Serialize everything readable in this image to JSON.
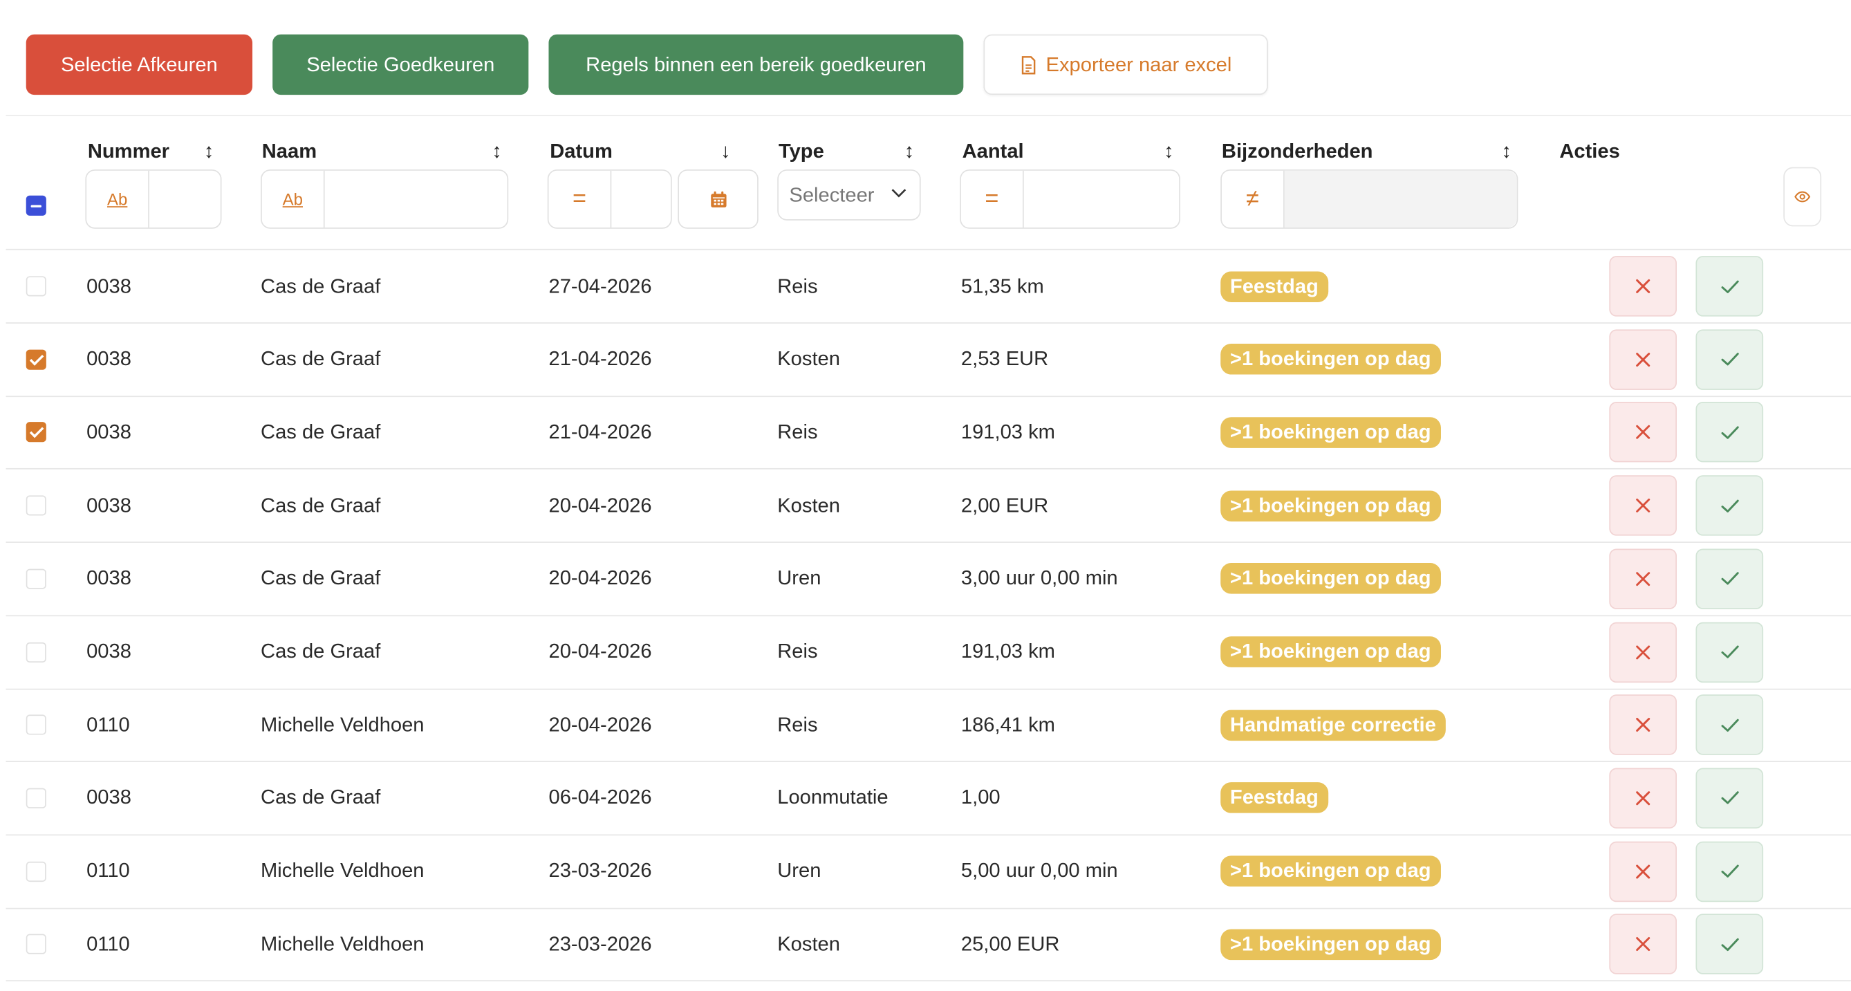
{
  "toolbar": {
    "reject_selection": "Selectie Afkeuren",
    "approve_selection": "Selectie Goedkeuren",
    "approve_range": "Regels binnen een bereik goedkeuren",
    "export_excel": "Exporteer naar excel"
  },
  "columns": {
    "nummer": "Nummer",
    "naam": "Naam",
    "datum": "Datum",
    "type": "Type",
    "aantal": "Aantal",
    "bijzonderheden": "Bijzonderheden",
    "acties": "Acties"
  },
  "filters": {
    "text_op": "Ab",
    "eq_op": "=",
    "neq_op": "≠",
    "type_placeholder": "Selecteer"
  },
  "colors": {
    "reject": "#d94f3b",
    "approve": "#4a8a5b",
    "accent": "#d67a2b",
    "badge": "#e8c25a",
    "master_checkbox": "#3b4fd8"
  },
  "rows": [
    {
      "checked": false,
      "nummer": "0038",
      "naam": "Cas de Graaf",
      "datum": "27-04-2026",
      "type": "Reis",
      "aantal": "51,35 km",
      "badge": "Feestdag"
    },
    {
      "checked": true,
      "nummer": "0038",
      "naam": "Cas de Graaf",
      "datum": "21-04-2026",
      "type": "Kosten",
      "aantal": "2,53 EUR",
      "badge": ">1 boekingen op dag"
    },
    {
      "checked": true,
      "nummer": "0038",
      "naam": "Cas de Graaf",
      "datum": "21-04-2026",
      "type": "Reis",
      "aantal": "191,03 km",
      "badge": ">1 boekingen op dag"
    },
    {
      "checked": false,
      "nummer": "0038",
      "naam": "Cas de Graaf",
      "datum": "20-04-2026",
      "type": "Kosten",
      "aantal": "2,00 EUR",
      "badge": ">1 boekingen op dag"
    },
    {
      "checked": false,
      "nummer": "0038",
      "naam": "Cas de Graaf",
      "datum": "20-04-2026",
      "type": "Uren",
      "aantal": "3,00 uur 0,00 min",
      "badge": ">1 boekingen op dag"
    },
    {
      "checked": false,
      "nummer": "0038",
      "naam": "Cas de Graaf",
      "datum": "20-04-2026",
      "type": "Reis",
      "aantal": "191,03 km",
      "badge": ">1 boekingen op dag"
    },
    {
      "checked": false,
      "nummer": "0110",
      "naam": "Michelle Veldhoen",
      "datum": "20-04-2026",
      "type": "Reis",
      "aantal": "186,41 km",
      "badge": "Handmatige correctie"
    },
    {
      "checked": false,
      "nummer": "0038",
      "naam": "Cas de Graaf",
      "datum": "06-04-2026",
      "type": "Loonmutatie",
      "aantal": "1,00",
      "badge": "Feestdag"
    },
    {
      "checked": false,
      "nummer": "0110",
      "naam": "Michelle Veldhoen",
      "datum": "23-03-2026",
      "type": "Uren",
      "aantal": "5,00 uur 0,00 min",
      "badge": ">1 boekingen op dag"
    },
    {
      "checked": false,
      "nummer": "0110",
      "naam": "Michelle Veldhoen",
      "datum": "23-03-2026",
      "type": "Kosten",
      "aantal": "25,00 EUR",
      "badge": ">1 boekingen op dag"
    }
  ]
}
